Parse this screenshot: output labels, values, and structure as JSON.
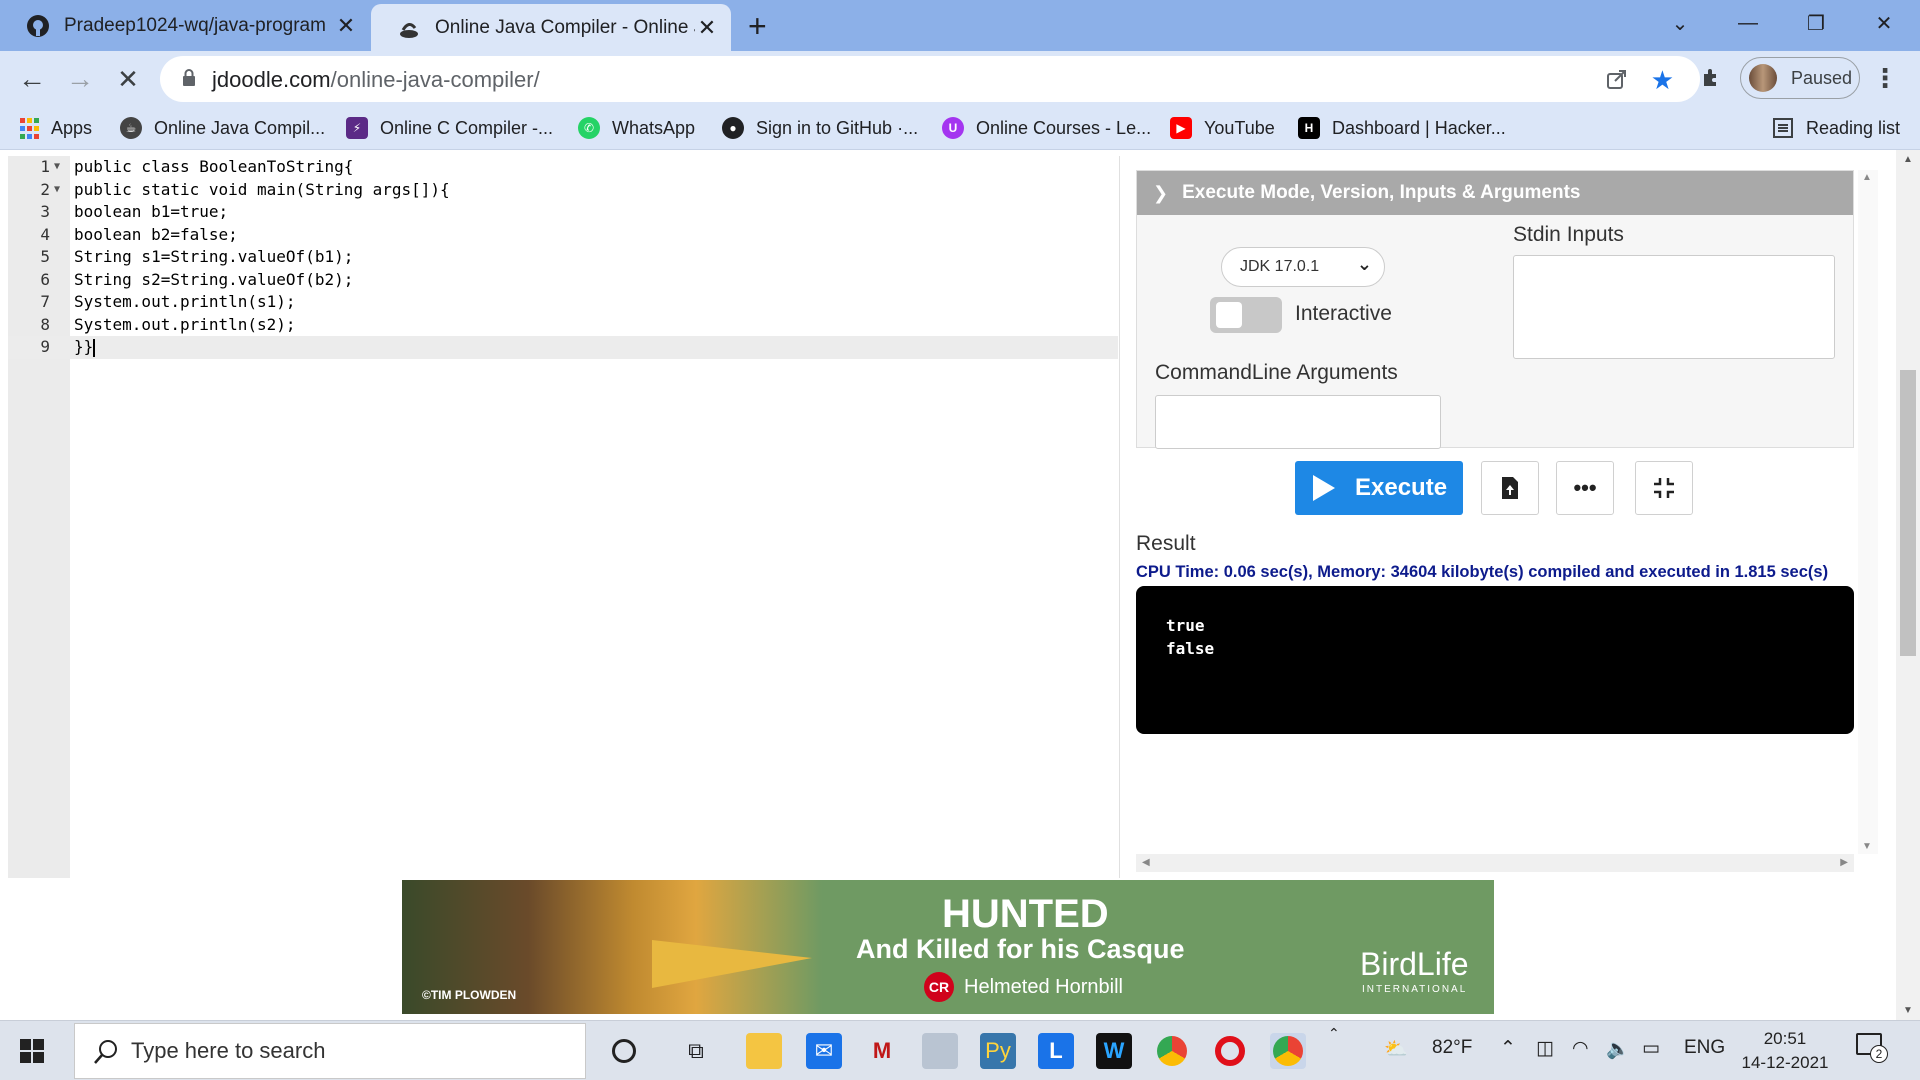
{
  "browser": {
    "tabs": [
      {
        "title": "Pradeep1024-wq/java-program",
        "active": false
      },
      {
        "title": "Online Java Compiler - Online Ja",
        "active": true
      }
    ],
    "url_domain": "jdoodle.com",
    "url_path": "/online-java-compiler/",
    "profile_label": "Paused",
    "bookmarks": [
      {
        "label": "Apps",
        "icon": "apps-grid-icon"
      },
      {
        "label": "Online Java Compil...",
        "icon": "java-icon"
      },
      {
        "label": "Online C Compiler -...",
        "icon": "c-compiler-icon"
      },
      {
        "label": "WhatsApp",
        "icon": "whatsapp-icon"
      },
      {
        "label": "Sign in to GitHub ·...",
        "icon": "github-icon"
      },
      {
        "label": "Online Courses - Le...",
        "icon": "udemy-icon"
      },
      {
        "label": "YouTube",
        "icon": "youtube-icon"
      },
      {
        "label": "Dashboard | Hacker...",
        "icon": "hackerrank-icon"
      }
    ],
    "reading_list": "Reading list"
  },
  "editor": {
    "line_numbers": [
      "1",
      "2",
      "3",
      "4",
      "5",
      "6",
      "7",
      "8",
      "9"
    ],
    "lines": [
      "public class BooleanToString{",
      "public static void main(String args[]){",
      "boolean b1=true;",
      "boolean b2=false;",
      "String s1=String.valueOf(b1);",
      "String s2=String.valueOf(b2);",
      "System.out.println(s1);",
      "System.out.println(s2);",
      "}}"
    ]
  },
  "panel": {
    "header": "Execute Mode, Version, Inputs & Arguments",
    "jdk_version": "JDK 17.0.1",
    "interactive_label": "Interactive",
    "stdin_label": "Stdin Inputs",
    "cmdline_label": "CommandLine Arguments",
    "execute_label": "Execute",
    "result_label": "Result",
    "stats": "CPU Time: 0.06 sec(s), Memory: 34604 kilobyte(s) compiled and executed in 1.815 sec(s)",
    "output": "true\nfalse"
  },
  "ad": {
    "headline": "HUNTED",
    "subline": "And Killed for his Casque",
    "badge": "CR",
    "species": "Helmeted Hornbill",
    "credit": "©TIM PLOWDEN",
    "logo": "BirdLife",
    "logo_sub": "INTERNATIONAL"
  },
  "taskbar": {
    "search_placeholder": "Type here to search",
    "weather": "82°F",
    "language": "ENG",
    "time": "20:51",
    "date": "14-12-2021",
    "notifications": "2"
  },
  "colors": {
    "accent": "#1e88e5",
    "tabstrip": "#8cb0e8",
    "toolbar": "#dbe6f8",
    "stats": "#0d1b8c"
  }
}
